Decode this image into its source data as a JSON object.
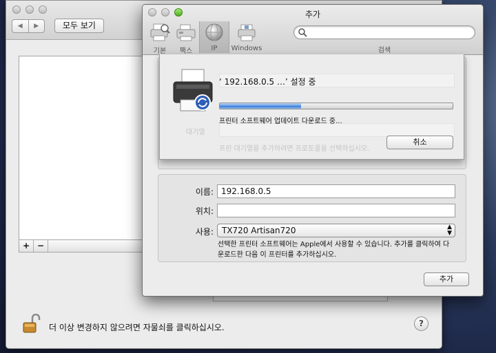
{
  "background_window": {
    "nav_back": "◀",
    "nav_forward": "▶",
    "show_all_label": "모두 보기",
    "list_add": "+",
    "list_remove": "−",
    "lock_text": "더 이상 변경하지 않으려면 자물쇠를 클릭하십시오.",
    "help_label": "?"
  },
  "dialog": {
    "title": "추가",
    "toolbar": [
      {
        "label": "기본",
        "icon": "default-printer-icon"
      },
      {
        "label": "팩스",
        "icon": "fax-icon"
      },
      {
        "label": "IP",
        "icon": "globe-icon"
      },
      {
        "label": "Windows",
        "icon": "windows-printer-icon"
      }
    ],
    "selected_tab": "IP",
    "search": {
      "label": "검색",
      "value": ""
    },
    "sheet": {
      "title": "‘ 192.168.0.5 …’ 설정 중",
      "progress": 0.35,
      "status": "프린터 소프트웨어 업데이트 다운로드 중...",
      "cancel_label": "취소",
      "ghost_label": "대기열",
      "ghost_hint": "프린 대기열을 추가하려면 프로토콜을 선택하십시오."
    },
    "form": {
      "name_label": "이름:",
      "name_value": "192.168.0.5",
      "location_label": "위치:",
      "location_value": "",
      "use_label": "사용:",
      "use_value": "TX720 Artisan720",
      "note": "선택한 프린터 소프트웨어는 Apple에서 사용할 수 있습니다. 추가를 클릭하여 다운로드한 다음 이 프린터를 추가하십시오."
    },
    "add_label": "추가"
  },
  "colors": {
    "progress": "#3a79d6",
    "traffic_green": "#5fc12e"
  }
}
